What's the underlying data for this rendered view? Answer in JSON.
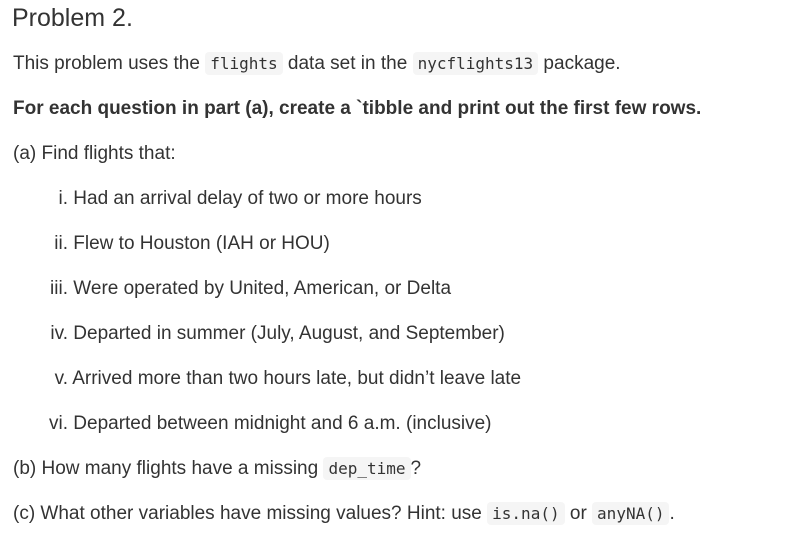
{
  "title": "Problem 2.",
  "intro": {
    "before_code1": "This problem uses the ",
    "code1": "flights",
    "between": " data set in the ",
    "code2": "nycflights13",
    "after": " package."
  },
  "instruction": "For each question in part (a), create a `tibble and print out the first few rows.",
  "part_a": {
    "label": "(a) Find flights that:",
    "items": [
      {
        "num": "i.",
        "text": "Had an arrival delay of two or more hours"
      },
      {
        "num": "ii.",
        "text": "Flew to Houston (IAH or HOU)"
      },
      {
        "num": "iii.",
        "text": "Were operated by United, American, or Delta"
      },
      {
        "num": "iv.",
        "text": "Departed in summer (July, August, and September)"
      },
      {
        "num": "v.",
        "text": "Arrived more than two hours late, but didn’t leave late"
      },
      {
        "num": "vi.",
        "text": "Departed between midnight and 6 a.m. (inclusive)"
      }
    ]
  },
  "part_b": {
    "before": "(b) How many flights have a missing ",
    "code": "dep_time",
    "after": "?"
  },
  "part_c": {
    "before": "(c) What other variables have missing values? Hint: use ",
    "code1": "is.na()",
    "between": " or ",
    "code2": "anyNA()",
    "after": "."
  }
}
